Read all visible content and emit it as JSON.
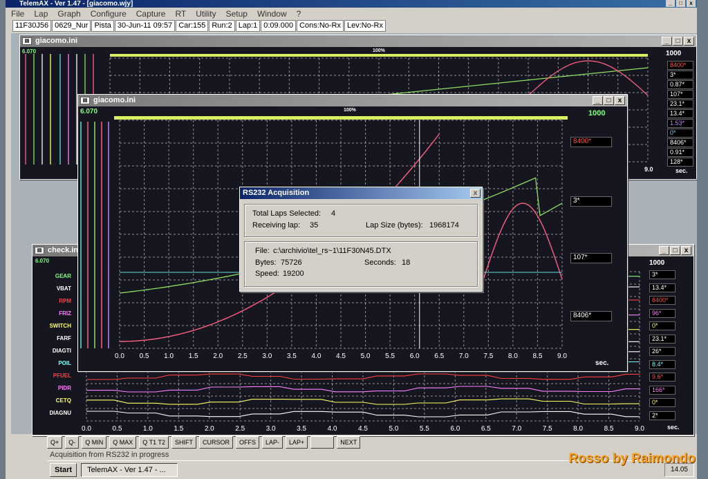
{
  "app": {
    "title": "TelemAX - Ver 1.47 - [giacomo.wjy]"
  },
  "menu": [
    "File",
    "Lap",
    "Graph",
    "Configure",
    "Capture",
    "RT",
    "Utility",
    "Setup",
    "Window",
    "?"
  ],
  "infobar": [
    "11F30J56",
    "0629_Nur",
    "Pista",
    "30-Jun-11 09:57",
    "Car:155",
    "Run:2",
    "Lap:1",
    "0:09.000",
    "Cons:No-Rx",
    "Lev:No-Rx"
  ],
  "win_back": {
    "title": "giacomo.ini",
    "top_left": "6.070",
    "top_mid": "100%",
    "top_right": "1000",
    "unit": "sec.",
    "end_tick": "9.0",
    "values": [
      {
        "text": "8400*",
        "color": "#ff5050"
      },
      {
        "text": "3*",
        "color": "#ffffff"
      },
      {
        "text": "0.87*",
        "color": "#ffffff"
      },
      {
        "text": "107*",
        "color": "#ffffff"
      },
      {
        "text": "23.1*",
        "color": "#ffffff"
      },
      {
        "text": "13.4*",
        "color": "#ffffff"
      },
      {
        "text": "1.53*",
        "color": "#c080ff"
      },
      {
        "text": "0*",
        "color": "#80d0ff"
      },
      {
        "text": "8406*",
        "color": "#ffffff"
      },
      {
        "text": "0.91*",
        "color": "#ffffff"
      },
      {
        "text": "128*",
        "color": "#ffffff"
      }
    ]
  },
  "win_front": {
    "title": "giacomo.ini",
    "top_left": "6.070",
    "top_mid": "100%",
    "top_right": "1000",
    "unit": "sec.",
    "values": [
      {
        "text": "8400*",
        "color": "#ff5050"
      },
      {
        "text": "3*",
        "color": "#ffffff"
      },
      {
        "text": "107*",
        "color": "#ffffff"
      },
      {
        "text": "8406*",
        "color": "#ffffff"
      }
    ]
  },
  "win_check": {
    "title": "check.ini",
    "top_left": "6.070",
    "top_right": "1000",
    "unit": "sec.",
    "channels": [
      {
        "name": "GEAR",
        "color": "#80ff80"
      },
      {
        "name": "VBAT",
        "color": "#ffffff"
      },
      {
        "name": "RPM",
        "color": "#ff4040"
      },
      {
        "name": "FRIZ",
        "color": "#ff80ff"
      },
      {
        "name": "SWITCH",
        "color": "#ffff60"
      },
      {
        "name": "FARF",
        "color": "#ffffff"
      },
      {
        "name": "DIAGTI",
        "color": "#ffffff"
      },
      {
        "name": "POIL",
        "color": "#80ffff"
      },
      {
        "name": "PFUEL",
        "color": "#ff4040"
      },
      {
        "name": "PIDR",
        "color": "#ff80ff"
      },
      {
        "name": "CETQ",
        "color": "#ffff60"
      },
      {
        "name": "DIAGNU",
        "color": "#ffffff"
      }
    ],
    "values": [
      {
        "text": "3*",
        "color": "#ffffff"
      },
      {
        "text": "13.4*",
        "color": "#ffffff"
      },
      {
        "text": "8400*",
        "color": "#ff5050"
      },
      {
        "text": "96*",
        "color": "#ff80ff"
      },
      {
        "text": "0*",
        "color": "#ffff60"
      },
      {
        "text": "23.1*",
        "color": "#ffffff"
      },
      {
        "text": "26*",
        "color": "#ffffff"
      },
      {
        "text": "8.4*",
        "color": "#80ffff"
      },
      {
        "text": "9.6*",
        "color": "#ff5050"
      },
      {
        "text": "166*",
        "color": "#ff80ff"
      },
      {
        "text": "0*",
        "color": "#ffff60"
      },
      {
        "text": "2*",
        "color": "#ffffff"
      }
    ]
  },
  "x_ticks": [
    "0.0",
    "0.5",
    "1.0",
    "1.5",
    "2.0",
    "2.5",
    "3.0",
    "3.5",
    "4.0",
    "4.5",
    "5.0",
    "5.5",
    "6.0",
    "6.5",
    "7.0",
    "7.5",
    "8.0",
    "8.5",
    "9.0"
  ],
  "colors": {
    "rpm": "#ff6080",
    "green": "#90e060",
    "cyan": "#60e0e0",
    "grid": "#c8c8c8"
  },
  "dialog": {
    "title": "RS232 Acquisition",
    "total_laps_label": "Total Laps Selected:",
    "total_laps_value": "4",
    "receiving_label": "Receiving lap:",
    "receiving_value": "35",
    "lap_size_label": "Lap Size (bytes):",
    "lap_size_value": "1968174",
    "file_label": "File:",
    "file_value": "c:\\archivio\\tel_rs~1\\11F30N45.DTX",
    "bytes_label": "Bytes:",
    "bytes_value": "75726",
    "seconds_label": "Seconds:",
    "seconds_value": "18",
    "speed_label": "Speed:",
    "speed_value": "19200"
  },
  "toolbar": [
    "Q+",
    "Q-",
    "Q MIN",
    "Q MAX",
    "Q T1 T2",
    "SHIFT",
    "CURSOR",
    "OFFS",
    "LAP-",
    "LAP+",
    "",
    "NEXT"
  ],
  "status": "Acquisition from RS232 in progress",
  "taskbar": {
    "start": "Start",
    "item": "TelemAX - Ver 1.47 - ...",
    "clock": "14.05"
  },
  "watermark": "Rosso by Raimondo"
}
